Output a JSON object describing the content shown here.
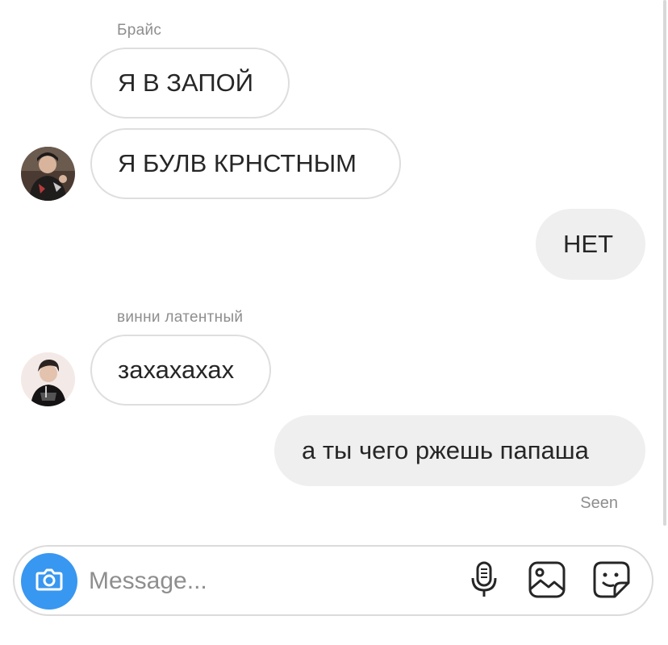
{
  "thread": {
    "groups": [
      {
        "sender": "Брайс",
        "messages": [
          "Я В ЗАПОЙ",
          "Я БУЛВ КРНСТНЫМ"
        ]
      },
      {
        "sender": "",
        "messages": [
          "НЕТ"
        ]
      },
      {
        "sender": "винни латентный",
        "messages": [
          "захахахах"
        ]
      },
      {
        "sender": "",
        "messages": [
          "а ты чего ржешь папаша"
        ]
      }
    ],
    "seen_label": "Seen"
  },
  "composer": {
    "placeholder": "Message..."
  },
  "icons": {
    "camera": "camera-icon",
    "microphone": "microphone-icon",
    "gallery": "gallery-icon",
    "sticker": "sticker-icon"
  },
  "colors": {
    "accent": "#3897f0",
    "outgoing_bubble": "#efefef",
    "incoming_border": "#dedede",
    "secondary_text": "#8e8e8e"
  }
}
